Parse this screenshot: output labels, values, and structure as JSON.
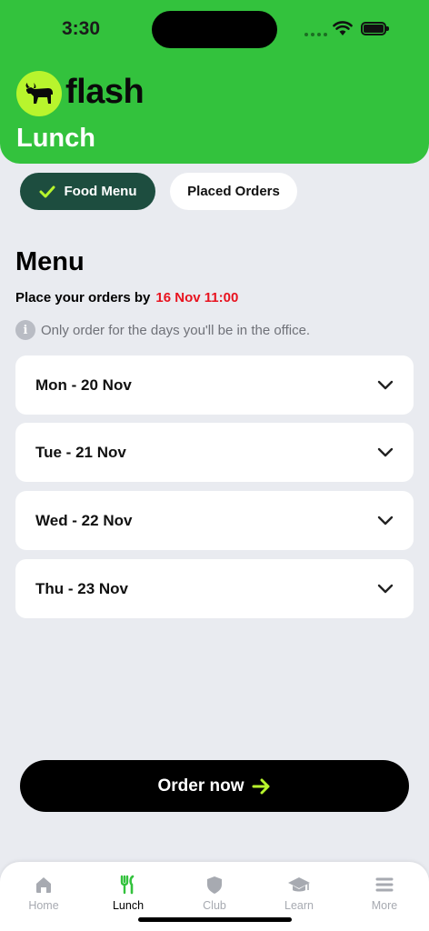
{
  "status_bar": {
    "time": "3:30"
  },
  "header": {
    "brand": "flash",
    "title": "Lunch"
  },
  "tabs": [
    {
      "label": "Food Menu",
      "active": true
    },
    {
      "label": "Placed Orders",
      "active": false
    }
  ],
  "menu": {
    "heading": "Menu",
    "deadline_prefix": "Place your orders by",
    "deadline_date": "16 Nov 11:00",
    "notice": "Only order for the days you'll be in the office.",
    "days": [
      {
        "label": "Mon - 20 Nov"
      },
      {
        "label": "Tue - 21 Nov"
      },
      {
        "label": "Wed - 22 Nov"
      },
      {
        "label": "Thu - 23 Nov"
      }
    ]
  },
  "order_button": {
    "label": "Order now"
  },
  "bottom_nav": [
    {
      "label": "Home",
      "icon": "home-icon",
      "active": false
    },
    {
      "label": "Lunch",
      "icon": "fork-knife-icon",
      "active": true
    },
    {
      "label": "Club",
      "icon": "shield-icon",
      "active": false
    },
    {
      "label": "Learn",
      "icon": "graduation-cap-icon",
      "active": false
    },
    {
      "label": "More",
      "icon": "menu-icon",
      "active": false
    }
  ],
  "colors": {
    "brand_green": "#33c23d",
    "accent_lime": "#b8f52d",
    "active_tab": "#1d4d3f",
    "deadline_red": "#e8131f",
    "background": "#e9ebf0"
  }
}
